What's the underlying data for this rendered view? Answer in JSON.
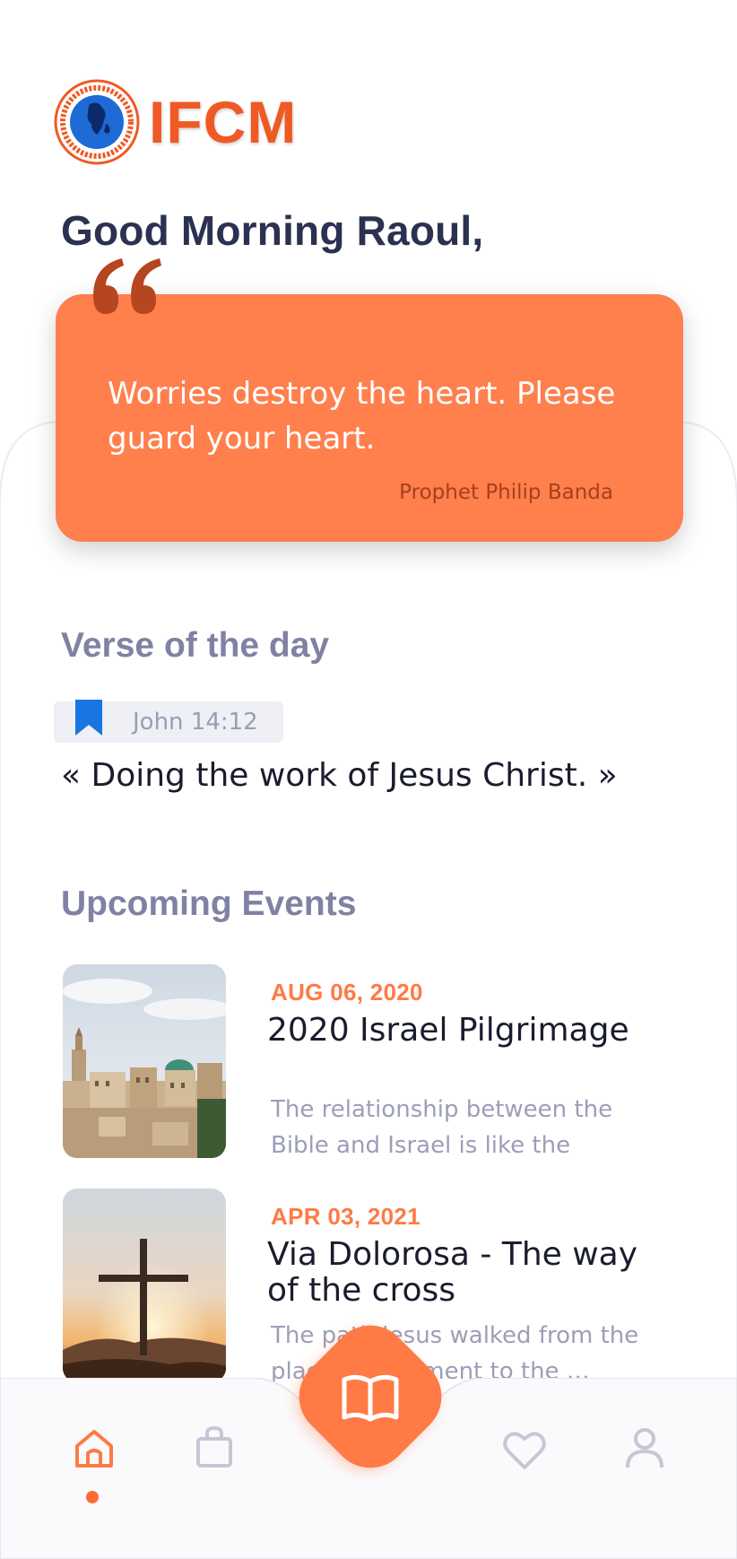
{
  "app": {
    "logo_text": "IFCM",
    "logo_seal_lettering": "IMPACT FOR CHRIST MINISTRIES • DOING THE WORKS OF JESUS CHRIST • JOHN 14:12",
    "brand_color": "#ef5a24"
  },
  "greeting": "Good Morning Raoul,",
  "quote": {
    "text": "Worries destroy the heart. Please guard your heart.",
    "author": "Prophet Philip Banda",
    "card_color": "#ff7f4d"
  },
  "verse": {
    "section_title": "Verse of the day",
    "reference": "John 14:12",
    "text": "« Doing the work of Jesus Christ. »",
    "icon": "bookmark-icon"
  },
  "events": {
    "section_title": "Upcoming Events",
    "items": [
      {
        "date": "AUG 06, 2020",
        "title": "2020 Israel Pilgrimage",
        "description": "The relationship between the Bible and Israel is like the body…",
        "image": "jerusalem-city-photo"
      },
      {
        "date": "APR 03, 2021",
        "title": "Via Dolorosa - The way of the cross",
        "description": "The path Jesus walked from the place of judgment to the …",
        "image": "cross-sunset-photo"
      }
    ]
  },
  "nav": {
    "items": [
      "home-icon",
      "shopping-bag-icon",
      "bible-icon",
      "heart-icon",
      "profile-icon"
    ],
    "active": "home-icon",
    "accent": "#ff7a45"
  }
}
